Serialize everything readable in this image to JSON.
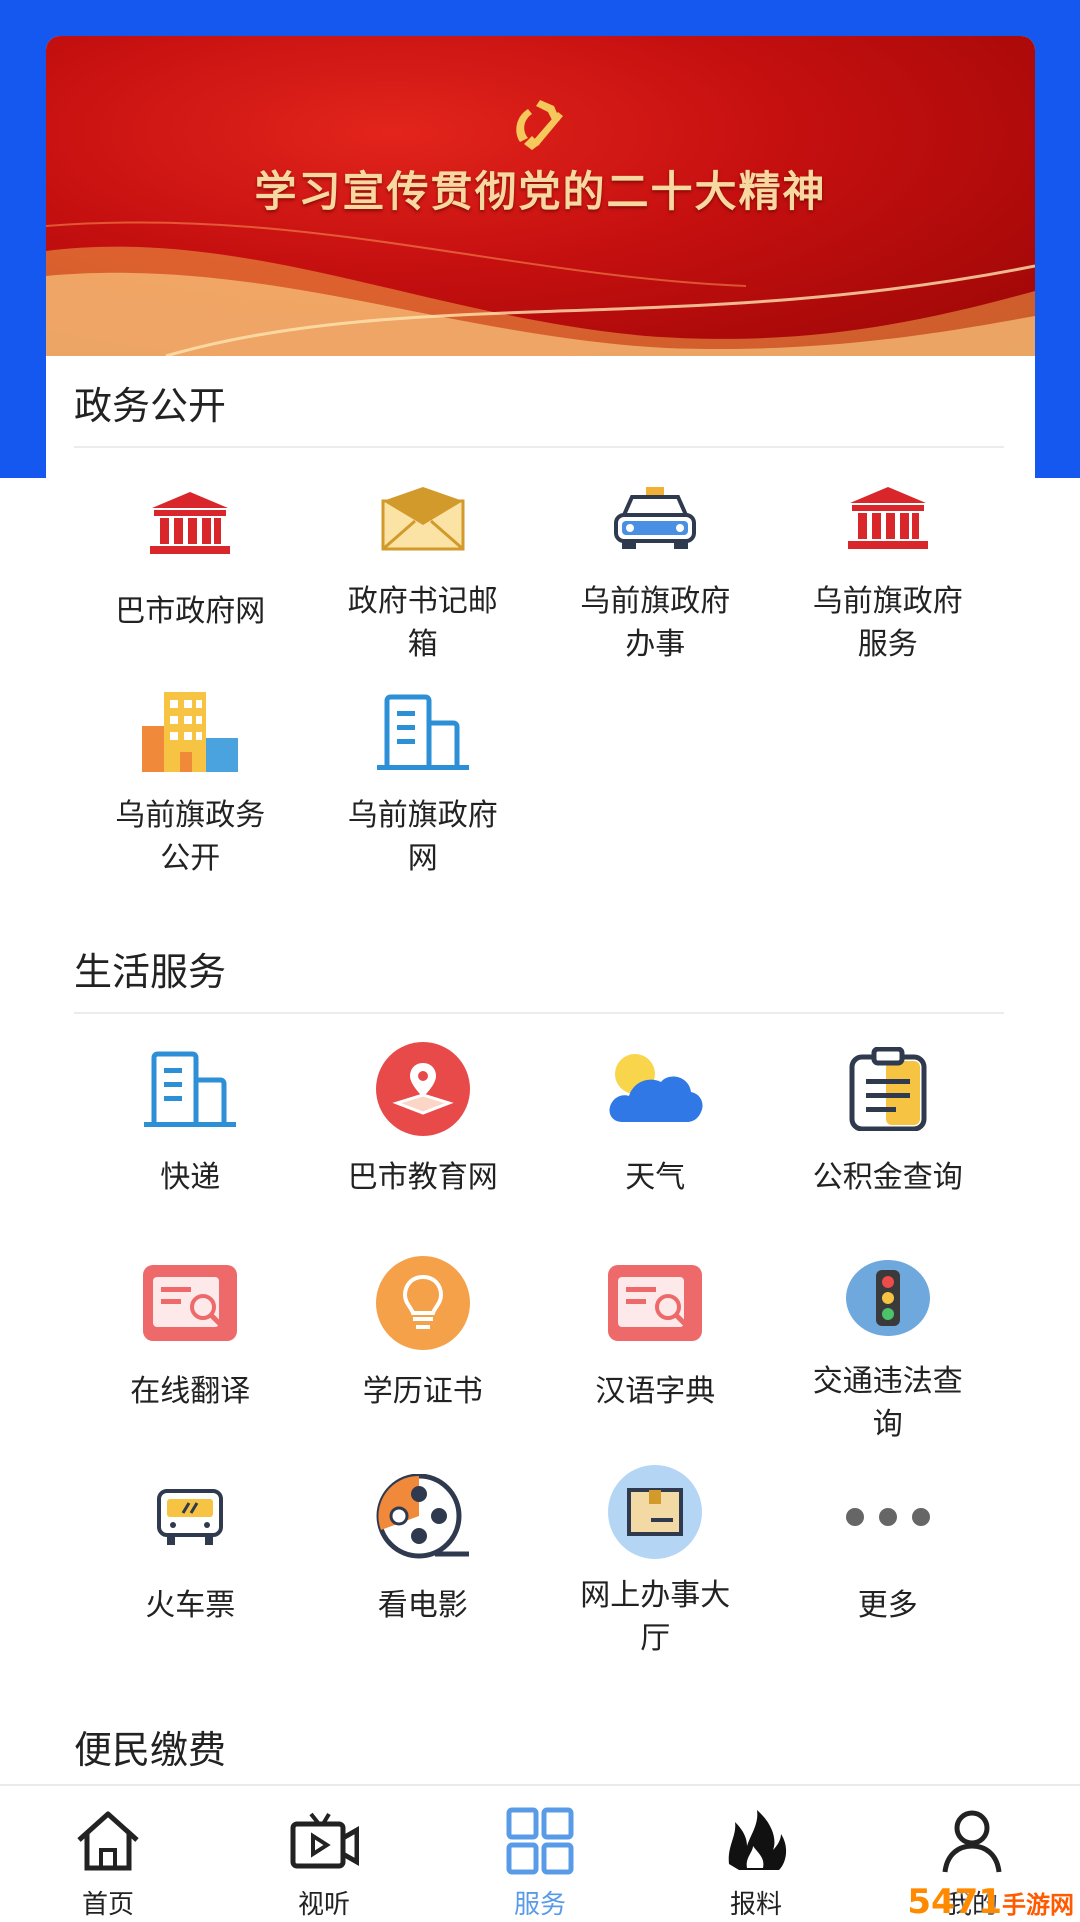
{
  "banner": {
    "title": "学习宣传贯彻党的二十大精神"
  },
  "sections": [
    {
      "title": "政务公开",
      "items": [
        {
          "label": "巴市政府网",
          "icon": "government-building-icon"
        },
        {
          "label": "政府书记邮箱",
          "icon": "envelope-icon"
        },
        {
          "label": "乌前旗政府办事",
          "icon": "taxi-icon"
        },
        {
          "label": "乌前旗政府服务",
          "icon": "government-building-icon"
        },
        {
          "label": "乌前旗政务公开",
          "icon": "city-buildings-icon"
        },
        {
          "label": "乌前旗政府网",
          "icon": "office-building-icon"
        }
      ]
    },
    {
      "title": "生活服务",
      "items": [
        {
          "label": "快递",
          "icon": "office-building-icon"
        },
        {
          "label": "巴市教育网",
          "icon": "map-pin-icon"
        },
        {
          "label": "天气",
          "icon": "weather-cloud-sun-icon"
        },
        {
          "label": "公积金查询",
          "icon": "clipboard-icon"
        },
        {
          "label": "在线翻译",
          "icon": "document-search-icon"
        },
        {
          "label": "学历证书",
          "icon": "lightbulb-icon"
        },
        {
          "label": "汉语字典",
          "icon": "document-search-icon"
        },
        {
          "label": "交通违法查询",
          "icon": "traffic-light-icon"
        },
        {
          "label": "火车票",
          "icon": "train-icon"
        },
        {
          "label": "看电影",
          "icon": "film-reel-icon"
        },
        {
          "label": "网上办事大厅",
          "icon": "package-box-icon"
        },
        {
          "label": "更多",
          "icon": "more-dots-icon"
        }
      ]
    },
    {
      "title": "便民缴费",
      "items": []
    }
  ],
  "nav": [
    {
      "label": "首页",
      "icon": "home-icon"
    },
    {
      "label": "视听",
      "icon": "video-icon"
    },
    {
      "label": "服务",
      "icon": "grid-icon",
      "active": true
    },
    {
      "label": "报料",
      "icon": "fire-icon"
    },
    {
      "label": "我的",
      "icon": "user-icon"
    }
  ],
  "watermark": {
    "text": "5471",
    "sub": "手游网"
  },
  "colors": {
    "header_blue": "#1558f0",
    "nav_active": "#5a9be8",
    "banner_red": "#c40f0f"
  }
}
